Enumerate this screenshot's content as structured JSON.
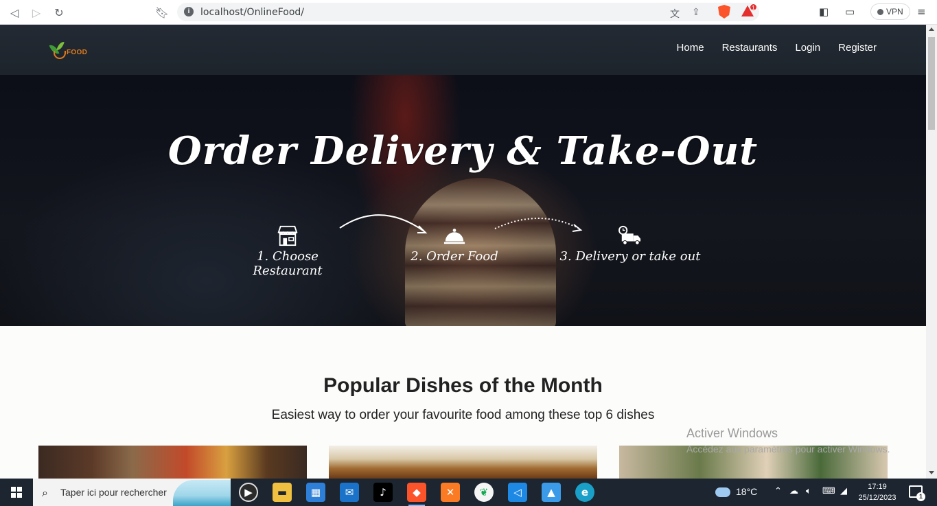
{
  "browser": {
    "url": "localhost/OnlineFood/",
    "vpn_label": "VPN",
    "rewards_count": "1"
  },
  "site": {
    "logo_text": "FOOD",
    "nav": [
      "Home",
      "Restaurants",
      "Login",
      "Register"
    ]
  },
  "hero": {
    "title": "Order Delivery & Take-Out",
    "steps": [
      {
        "label": "1. Choose Restaurant",
        "icon": "storefront-icon"
      },
      {
        "label": "2. Order Food",
        "icon": "cloche-icon"
      },
      {
        "label": "3. Delivery or take out",
        "icon": "delivery-truck-icon"
      }
    ]
  },
  "popular": {
    "title": "Popular Dishes of the Month",
    "subtitle": "Easiest way to order your favourite food among these top 6 dishes"
  },
  "watermark": {
    "title": "Activer Windows",
    "subtitle": "Accédez aux paramètres pour activer Windows."
  },
  "taskbar": {
    "search_placeholder": "Taper ici pour rechercher",
    "weather": "18°C",
    "time": "17:19",
    "date": "25/12/2023",
    "notification_count": "1",
    "apps": [
      "media-player-icon",
      "file-explorer-icon",
      "microsoft-store-icon",
      "mail-icon",
      "tiktok-icon",
      "brave-icon",
      "xampp-icon",
      "mongodb-compass-icon",
      "vscode-icon",
      "photos-icon",
      "edge-icon"
    ]
  }
}
